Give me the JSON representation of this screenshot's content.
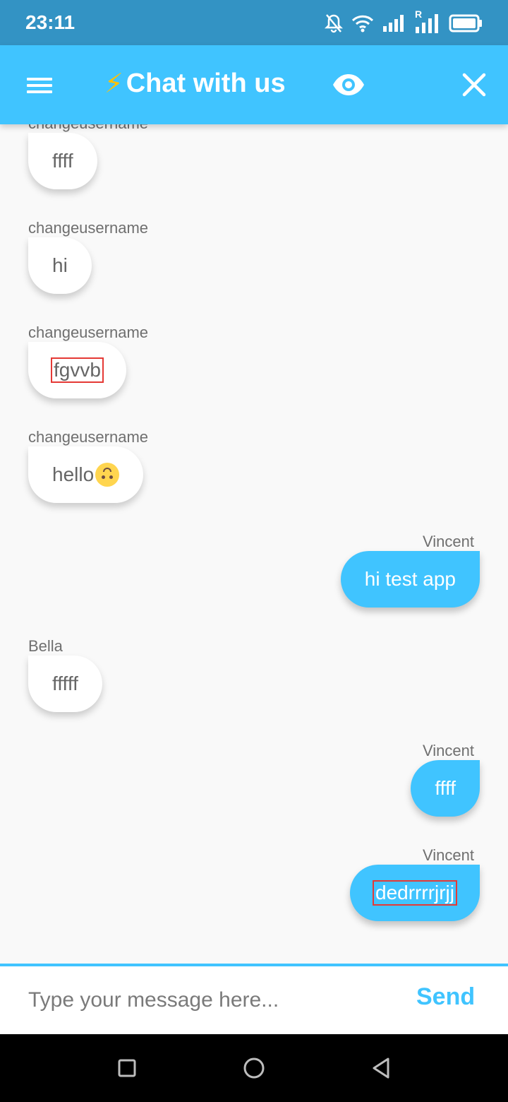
{
  "status_bar": {
    "time": "23:11",
    "roaming_label": "R"
  },
  "app_bar": {
    "title": "Chat with us",
    "title_emoji": "⚡"
  },
  "messages": [
    {
      "sender": "changeusername",
      "text": "ffff",
      "direction": "in"
    },
    {
      "sender": "changeusername",
      "text": "hi",
      "direction": "in"
    },
    {
      "sender": "changeusername",
      "text": "fgvvb",
      "direction": "in"
    },
    {
      "sender": "changeusername",
      "text": "hello",
      "emoji": "upside-down-face",
      "direction": "in"
    },
    {
      "sender": "Vincent",
      "text": "hi test app",
      "direction": "out"
    },
    {
      "sender": "Bella",
      "text": "fffff",
      "direction": "in"
    },
    {
      "sender": "Vincent",
      "text": "ffff",
      "direction": "out"
    },
    {
      "sender": "Vincent",
      "text": "dedrrrrjrjj",
      "direction": "out"
    }
  ],
  "composer": {
    "placeholder": "Type your message here...",
    "value": "",
    "send_label": "Send"
  },
  "colors": {
    "accent": "#40c4ff",
    "status_bar": "#3393c4",
    "emoji_bolt": "#ffc107"
  }
}
